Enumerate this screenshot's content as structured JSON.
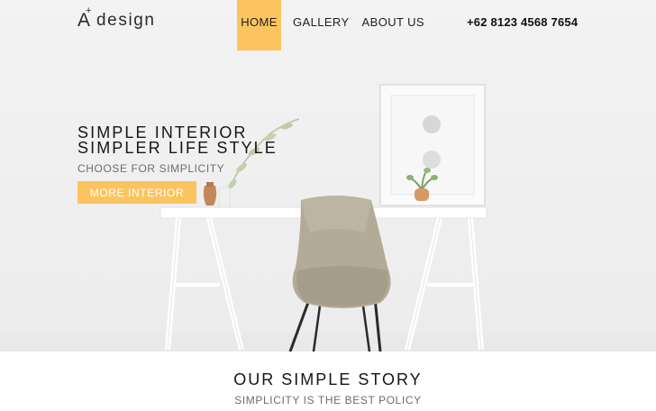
{
  "header": {
    "logo_mark": "A",
    "logo_plus": "+",
    "logo_text": "design",
    "phone": "+62 8123 4568 7654"
  },
  "nav": {
    "items": [
      {
        "label": "HOME",
        "active": true
      },
      {
        "label": "GALLERY",
        "active": false
      },
      {
        "label": "ABOUT US",
        "active": false
      }
    ]
  },
  "hero": {
    "title_line1": "SIMPLE INTERIOR",
    "title_line2": "SIMPLER LIFE STYLE",
    "subtitle": "CHOOSE FOR SIMPLICITY",
    "button_label": "MORE INTERIOR"
  },
  "story": {
    "title": "OUR SIMPLE STORY",
    "subtitle": "SIMPLICITY IS THE BEST POLICY"
  },
  "colors": {
    "accent": "#fcc45f",
    "text_dark": "#151515",
    "text_muted": "#6d6d6d"
  }
}
